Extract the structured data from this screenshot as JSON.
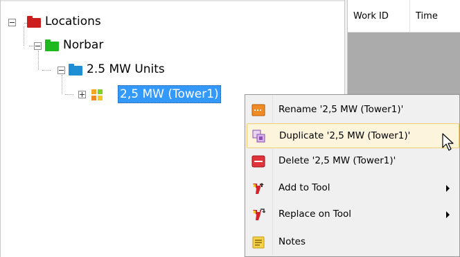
{
  "tree": {
    "root": {
      "label": "Locations",
      "icon": "red-folder-icon",
      "color": "#cc1e1e"
    },
    "child": {
      "label": "Norbar",
      "icon": "green-folder-icon",
      "color": "#1fb81f"
    },
    "grandchild": {
      "label": "2.5 MW Units",
      "icon": "blue-folder-icon",
      "color": "#1e8fd4"
    },
    "selected": {
      "label": "2,5 MW (Tower1)",
      "icon": "multicolor-grid-icon"
    }
  },
  "grid": {
    "columns": [
      "Work ID",
      "Time"
    ]
  },
  "context_menu": {
    "items": [
      {
        "label": "Rename '2,5 MW (Tower1)'",
        "icon": "rename-icon",
        "submenu": false
      },
      {
        "label": "Duplicate '2,5 MW (Tower1)'",
        "icon": "duplicate-icon",
        "submenu": false,
        "hover": true
      },
      {
        "label": "Delete '2,5 MW (Tower1)'",
        "icon": "delete-icon",
        "submenu": false
      },
      {
        "label": "Add to Tool",
        "icon": "wrench-add-icon",
        "submenu": true
      },
      {
        "label": "Replace on Tool",
        "icon": "wrench-replace-icon",
        "submenu": true
      },
      {
        "label": "Notes",
        "icon": "notes-icon",
        "submenu": false
      }
    ]
  },
  "colors": {
    "selection": "#3399ff",
    "menu_hover_bg": "#fdf4dc",
    "menu_hover_border": "#f2cf74",
    "grid_bg": "#ababab"
  }
}
